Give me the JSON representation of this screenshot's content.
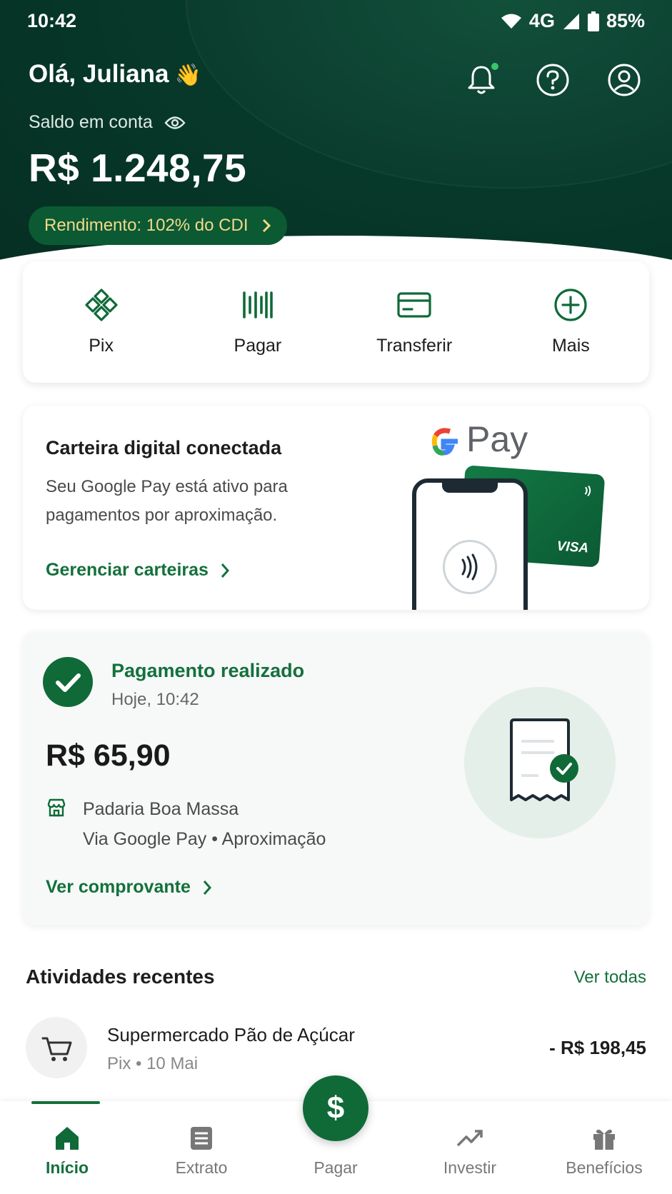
{
  "status_bar": {
    "time": "10:42",
    "network": "4G",
    "battery": "85%"
  },
  "header": {
    "greeting": "Olá, Juliana",
    "greeting_emoji": "👋",
    "balance_label": "Saldo em conta",
    "balance": "R$ 1.248,75",
    "yield_label": "Rendimento: 102% do CDI"
  },
  "quick_actions": [
    {
      "label": "Pix",
      "icon": "pix-icon"
    },
    {
      "label": "Pagar",
      "icon": "barcode-icon"
    },
    {
      "label": "Transferir",
      "icon": "card-icon"
    },
    {
      "label": "Mais",
      "icon": "plus-circle-icon"
    }
  ],
  "wallet_card": {
    "title": "Carteira digital conectada",
    "description": "Seu Google Pay está ativo para pagamentos por aproximação.",
    "link": "Gerenciar carteiras",
    "gpay_text": "Pay",
    "card_brand": "VISA"
  },
  "payment_card": {
    "title": "Pagamento realizado",
    "time": "Hoje, 10:42",
    "amount": "R$ 65,90",
    "merchant": "Padaria Boa Massa",
    "method": "Via Google Pay • Aproximação",
    "link": "Ver comprovante"
  },
  "recent": {
    "title": "Atividades recentes",
    "see_all": "Ver todas",
    "items": [
      {
        "name": "Supermercado Pão de Açúcar",
        "sub": "Pix • 10 Mai",
        "amount": "- R$ 198,45"
      }
    ]
  },
  "bottom_nav": {
    "items": [
      {
        "label": "Início",
        "icon": "home-icon"
      },
      {
        "label": "Extrato",
        "icon": "statement-icon"
      },
      {
        "label": "Pagar",
        "icon": "dollar-icon"
      },
      {
        "label": "Investir",
        "icon": "trending-up-icon"
      },
      {
        "label": "Benefícios",
        "icon": "gift-icon"
      }
    ],
    "fab_symbol": "$"
  },
  "colors": {
    "primary": "#0f6a38",
    "header_dark": "#052e22",
    "yield_text": "#f1d98b"
  }
}
